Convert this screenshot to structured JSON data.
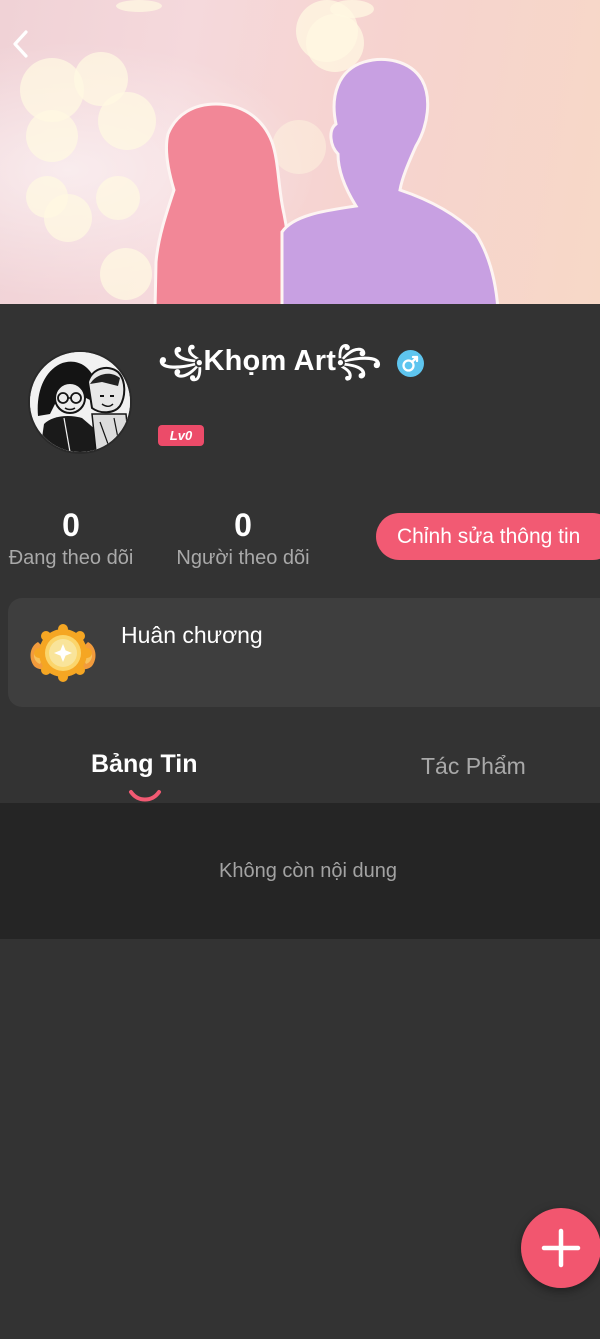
{
  "header": {
    "back_icon": "chevron-left-icon"
  },
  "profile": {
    "name": "꧁Khọm Art꧂",
    "gender_icon": "male-icon",
    "level": "Lv0"
  },
  "stats": {
    "following_count": "0",
    "following_label": "Đang theo dõi",
    "followers_count": "0",
    "followers_label": "Người theo dõi"
  },
  "actions": {
    "edit_label": "Chỉnh sửa thông tin",
    "add_icon": "plus-icon"
  },
  "medals": {
    "label": "Huân chương",
    "icon": "medal-icon"
  },
  "tabs": [
    {
      "label": "Bảng Tin",
      "active": true
    },
    {
      "label": "Tác Phẩm",
      "active": false
    }
  ],
  "feed": {
    "empty_text": "Không còn nội dung"
  },
  "colors": {
    "accent": "#f25a73",
    "background": "#333333",
    "content_bg": "#252525",
    "gender_badge": "#5ec5ef"
  }
}
